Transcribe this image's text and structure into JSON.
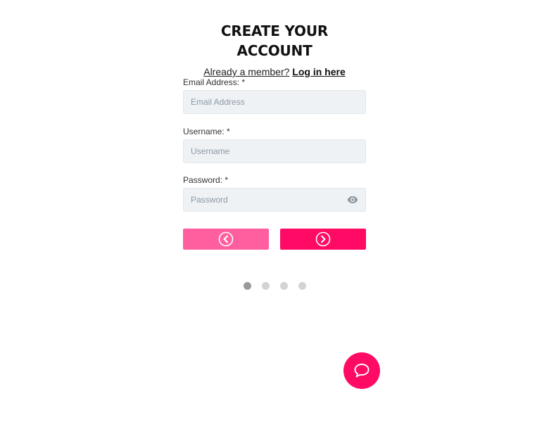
{
  "form": {
    "title": "CREATE YOUR ACCOUNT",
    "login_prompt": "Already a member?",
    "login_link": "Log in here"
  },
  "fields": [
    {
      "label": "Email Address: *",
      "placeholder": "Email Address",
      "value": ""
    },
    {
      "label": "Username: *",
      "placeholder": "Username",
      "value": ""
    },
    {
      "label": "Password: *",
      "placeholder": "Password",
      "value": ""
    }
  ],
  "buttons": {
    "prev_icon": "chevron-left-circle-icon",
    "next_icon": "chevron-right-circle-icon"
  },
  "steps": {
    "total": 4,
    "current": 1
  },
  "chat": {
    "icon": "chat-bubble-icon"
  },
  "colors": {
    "accent": "#ff0a64",
    "accent_light": "#ff5f9e",
    "input_bg": "#eef2f5",
    "dot_active": "#999999",
    "dot_inactive": "#d3d3d3"
  }
}
